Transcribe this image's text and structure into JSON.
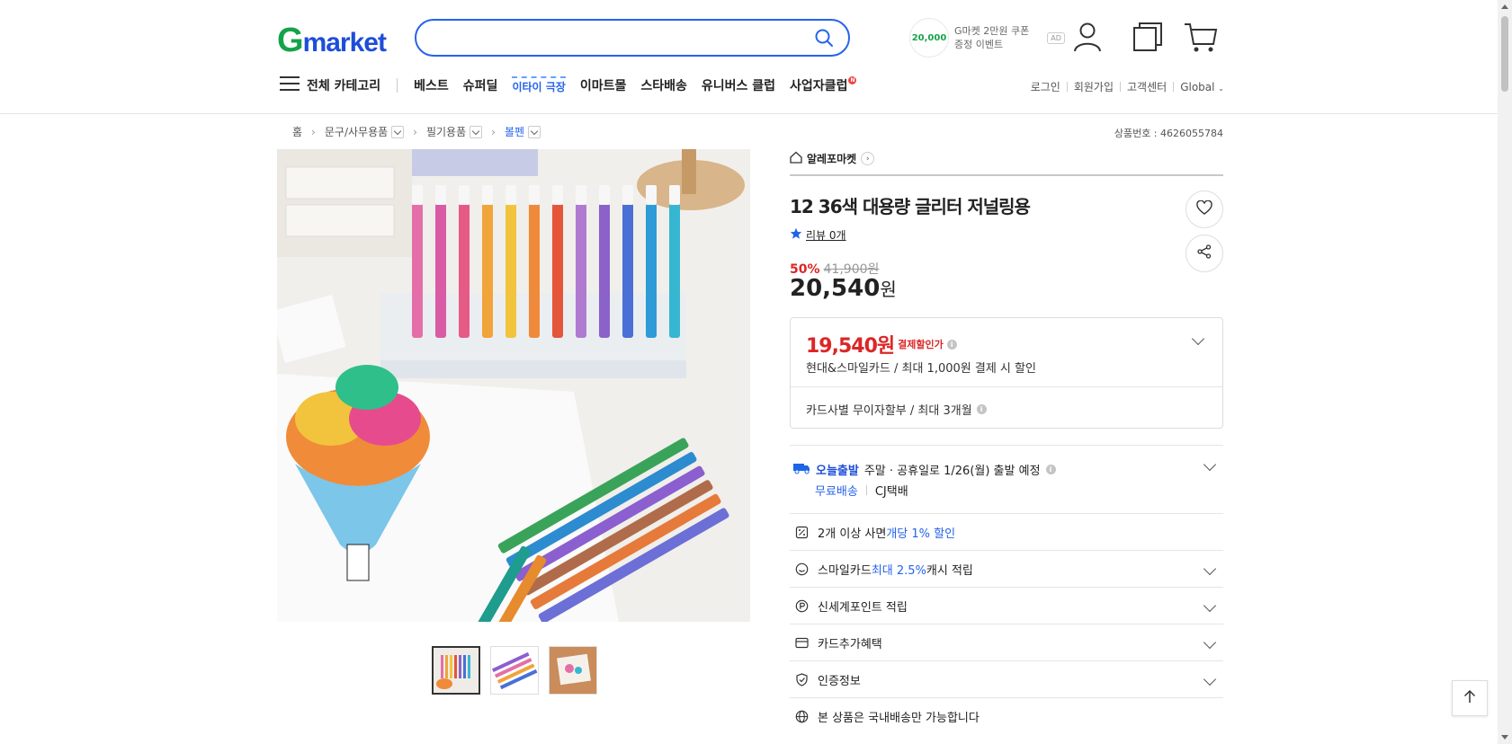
{
  "header": {
    "logo_g": "G",
    "logo_rest": "market",
    "search_placeholder": "",
    "promo_badge": "20,000",
    "promo_line1": "G마켓 2만원 쿠폰",
    "promo_line2": "증정 이벤트",
    "promo_ad": "AD"
  },
  "nav": {
    "category": "전체 카테고리",
    "items": [
      "베스트",
      "슈퍼딜",
      "이타이 극장",
      "이마트몰",
      "스타배송",
      "유니버스 클럽",
      "사업자클럽"
    ],
    "new_badge": "N",
    "util": [
      "로그인",
      "회원가입",
      "고객센터",
      "Global"
    ]
  },
  "breadcrumb": {
    "items": [
      "홈",
      "문구/사무용품",
      "필기용품",
      "볼펜"
    ],
    "product_no": "상품번호 : 4626055784"
  },
  "product": {
    "seller": "알레포마켓",
    "title": "12 36색 대용량 글리터 저널링용",
    "review": "리뷰 0개",
    "discount_pct": "50%",
    "original_price": "41,900원",
    "price": "20,540",
    "price_unit": "원",
    "card_price": "19,540원",
    "card_price_label": "결제할인가",
    "card_desc": "현대&스마일카드 / 최대 1,000원 결제 시 할인",
    "installment": "카드사별 무이자할부 / 최대 3개월"
  },
  "shipping": {
    "today_label": "오늘출발",
    "today_desc": "주말 · 공휴일로 1/26(월) 출발 예정",
    "free": "무료배송",
    "carrier": "CJ택배"
  },
  "benefits": [
    {
      "pre": "2개 이상 사면 ",
      "hl": "개당 1% 할인",
      "post": ""
    },
    {
      "pre": "스마일카드 ",
      "hl": "최대 2.5%",
      "post": " 캐시 적립"
    },
    {
      "pre": "신세계포인트 적립",
      "hl": "",
      "post": ""
    },
    {
      "pre": "카드추가혜택",
      "hl": "",
      "post": ""
    },
    {
      "pre": "인증정보",
      "hl": "",
      "post": ""
    },
    {
      "pre": "본 상품은 국내배송만 가능합니다",
      "hl": "",
      "post": ""
    }
  ],
  "colors": {
    "accent_blue": "#2563eb",
    "sale_red": "#dc2626",
    "logo_green": "#15a34a"
  },
  "icons": {
    "search": "search-icon",
    "user": "user-icon",
    "recent": "recent-items-icon",
    "cart": "cart-icon",
    "menu": "hamburger-icon",
    "heart": "heart-icon",
    "share": "share-icon",
    "star": "star-icon",
    "home": "store-home-icon",
    "top": "arrow-up-icon"
  }
}
